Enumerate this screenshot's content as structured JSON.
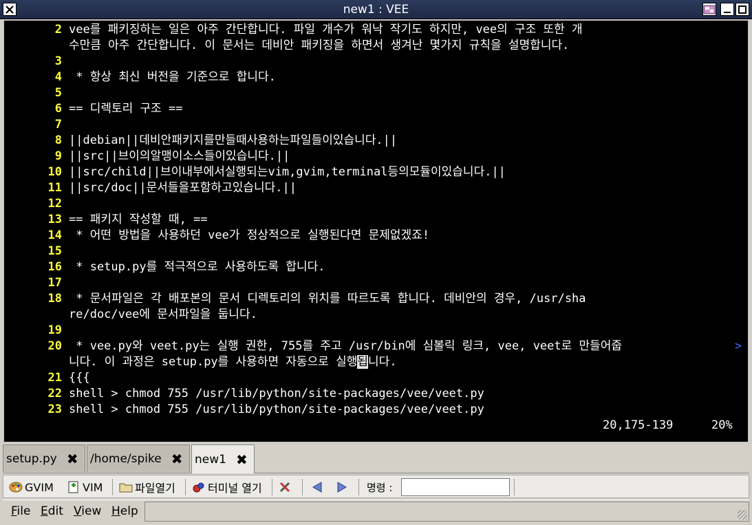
{
  "window": {
    "title": "new1 : VEE"
  },
  "editor": {
    "lines": [
      {
        "num": "2",
        "text": "vee를 패키징하는 일은 아주 간단합니다. 파일 개수가 워낙 작기도 하지만, vee의 구조 또한 개"
      },
      {
        "num": "",
        "text": "수만큼 아주 간단합니다. 이 문서는 데비안 패키징을 하면서 생겨난 몇가지 규칙을 설명합니다."
      },
      {
        "num": "3",
        "text": ""
      },
      {
        "num": "4",
        "text": " * 항상 최신 버전을 기준으로 합니다."
      },
      {
        "num": "5",
        "text": ""
      },
      {
        "num": "6",
        "text": "== 디렉토리 구조 =="
      },
      {
        "num": "7",
        "text": ""
      },
      {
        "num": "8",
        "text": "||debian||데비안패키지를만들때사용하는파일들이있습니다.||"
      },
      {
        "num": "9",
        "text": "||src||브이의알맹이소스들이있습니다.||"
      },
      {
        "num": "10",
        "text": "||src/child||브이내부에서실행되는vim,gvim,terminal등의모듈이있습니다.||"
      },
      {
        "num": "11",
        "text": "||src/doc||문서들을포함하고있습니다.||"
      },
      {
        "num": "12",
        "text": ""
      },
      {
        "num": "13",
        "text": "== 패키지 작성할 때, =="
      },
      {
        "num": "14",
        "text": " * 어떤 방법을 사용하던 vee가 정상적으로 실행된다면 문제없겠죠!"
      },
      {
        "num": "15",
        "text": ""
      },
      {
        "num": "16",
        "text": " * setup.py를 적극적으로 사용하도록 합니다."
      },
      {
        "num": "17",
        "text": ""
      },
      {
        "num": "18",
        "text": " * 문서파일은 각 배포본의 문서 디렉토리의 위치를 따르도록 합니다. 데비안의 경우, /usr/sha"
      },
      {
        "num": "",
        "text": "re/doc/vee에 문서파일을 둡니다."
      },
      {
        "num": "19",
        "text": ""
      },
      {
        "num": "20",
        "text": " * vee.py와 veet.py는 실행 권한, 755를 주고 /usr/bin에 심볼릭 링크, vee, veet로 만들어줍"
      },
      {
        "num": "",
        "text": "니다. 이 과정은 setup.py를 사용하면 자동으로 실행"
      },
      {
        "num": "21",
        "text": "{{{"
      },
      {
        "num": "22",
        "text": "shell > chmod 755 /usr/lib/python/site-packages/vee/veet.py"
      },
      {
        "num": "23",
        "text": "shell > chmod 755 /usr/lib/python/site-packages/vee/veet.py"
      }
    ],
    "wrap_marker": ">",
    "cursor_char": "됩",
    "after_cursor": "니다.",
    "ruler": "20,175-139",
    "percent": "20%"
  },
  "tabs": [
    {
      "label": "setup.py",
      "close": "✖"
    },
    {
      "label": "/home/spike",
      "close": "✖"
    },
    {
      "label": "new1",
      "close": "✖",
      "active": true
    }
  ],
  "toolbar": {
    "gvim_label": "GVIM",
    "vim_label": "VIM",
    "open_file_label": "파일열기",
    "terminal_label": "터미널 열기",
    "command_label": "명령 :",
    "command_value": ""
  },
  "menubar": {
    "file": "File",
    "edit": "Edit",
    "view": "View",
    "help": "Help"
  }
}
